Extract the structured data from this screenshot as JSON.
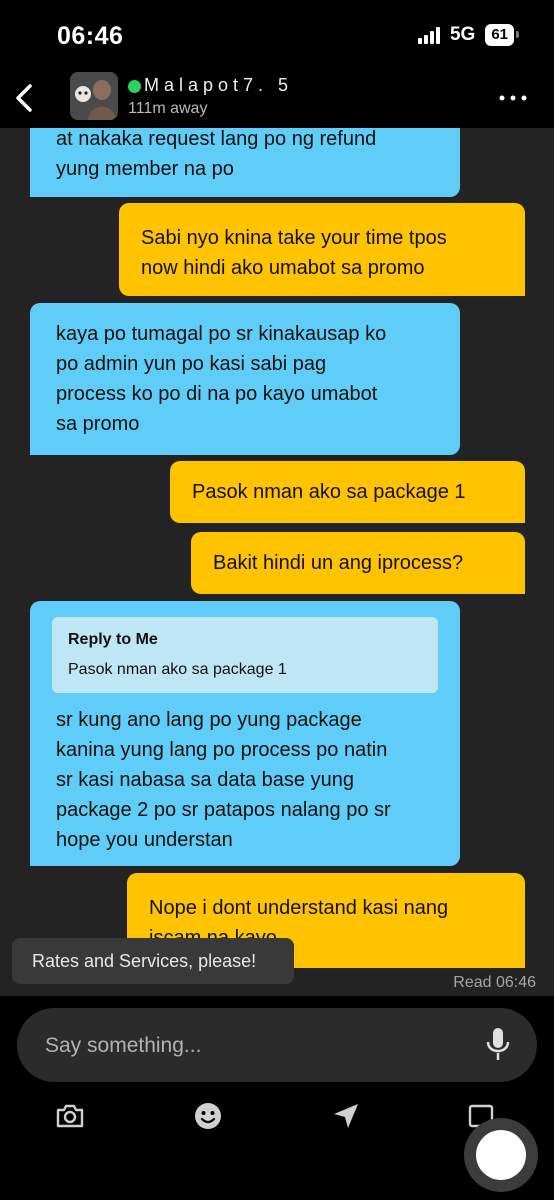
{
  "status_bar": {
    "time": "06:46",
    "network": "5G",
    "battery": "61"
  },
  "header": {
    "name": "Malapot7. 5",
    "distance": "111m away"
  },
  "messages": [
    {
      "dir": "in",
      "text": "at nakaka request lang po ng refund\nyung member na po"
    },
    {
      "dir": "out",
      "text": "Sabi nyo knina take your time tpos\nnow hindi ako umabot sa promo"
    },
    {
      "dir": "in",
      "text": "kaya po tumagal po sr kinakausap ko\npo admin yun po kasi sabi pag\nprocess ko po di na po kayo umabot\nsa promo"
    },
    {
      "dir": "out",
      "text": "Pasok nman ako sa package 1"
    },
    {
      "dir": "out",
      "text": "Bakit hindi un ang iprocess?"
    },
    {
      "dir": "in",
      "reply_to": "Reply to Me",
      "reply_text": "Pasok nman ako sa package 1",
      "text": "sr kung ano lang po yung package\nkanina yung lang po process po natin\nsr kasi nabasa sa data base yung\npackage 2 po sr patapos nalang po sr\nhope you understan"
    },
    {
      "dir": "out",
      "text": "Nope i dont understand kasi nang\niscam na kayo"
    }
  ],
  "quick_reply": "Rates and Services, please!",
  "read_receipt": "Read 06:46",
  "composer": {
    "placeholder": "Say something..."
  },
  "icons": {
    "back": "chevron-left-icon",
    "more": "more-horizontal-icon",
    "mic": "microphone-icon",
    "camera": "camera-icon",
    "sticker": "smiley-icon",
    "location": "location-arrow-icon",
    "gallery": "gallery-icon"
  },
  "colors": {
    "incoming": "#5fcdf8",
    "outgoing": "#ffc300",
    "online": "#2ad35a"
  }
}
